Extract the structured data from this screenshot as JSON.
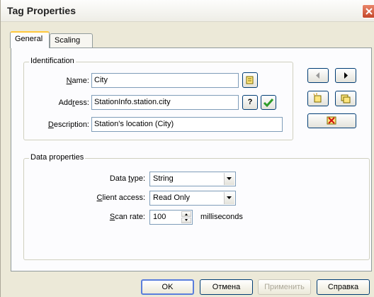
{
  "window": {
    "title": "Tag Properties"
  },
  "tabs": [
    {
      "label": "General",
      "active": true
    },
    {
      "label": "Scaling",
      "active": false
    }
  ],
  "identification": {
    "legend": "Identification",
    "name": {
      "label_pre": "",
      "label_u": "N",
      "label_post": "ame:",
      "value": "City"
    },
    "address": {
      "label_pre": "Add",
      "label_u": "r",
      "label_post": "ess:",
      "value": "StationInfo.station.city"
    },
    "description": {
      "label_pre": "",
      "label_u": "D",
      "label_post": "escription:",
      "value": "Station's location (City)"
    },
    "browse_button_label": "?"
  },
  "data_properties": {
    "legend": "Data properties",
    "data_type": {
      "label_pre": "Data ",
      "label_u": "t",
      "label_post": "ype:",
      "value": "String"
    },
    "client_access": {
      "label_pre": "",
      "label_u": "C",
      "label_post": "lient access:",
      "value": "Read Only"
    },
    "scan_rate": {
      "label_pre": "",
      "label_u": "S",
      "label_post": "can rate:",
      "value": "100",
      "unit": "milliseconds"
    }
  },
  "footer": {
    "ok": "OK",
    "cancel": "Отмена",
    "apply": "Применить",
    "help": "Справка"
  },
  "colors": {
    "accent_green": "#2e9c28",
    "tab_highlight": "#ffc83c",
    "close_red": "#c4472a"
  }
}
